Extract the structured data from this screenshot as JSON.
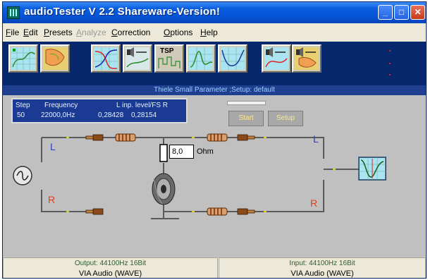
{
  "window": {
    "title": "audioTester  V 2.2 Shareware-Version!",
    "icons": [
      "app-icon",
      "minimize-icon",
      "maximize-icon",
      "close-icon"
    ]
  },
  "menu": {
    "items": [
      {
        "label": "File",
        "enabled": true
      },
      {
        "label": "Edit",
        "enabled": true
      },
      {
        "label": "Presets",
        "enabled": true
      },
      {
        "label": "Analyze",
        "enabled": false
      },
      {
        "label": "Correction",
        "enabled": true
      },
      {
        "label": "Options",
        "enabled": true
      },
      {
        "label": "Help",
        "enabled": true
      }
    ]
  },
  "toolbar": {
    "tsp_label": "TSP",
    "buttons": [
      "frequency-response-icon",
      "spectrum-map-icon",
      "filter-curve-icon",
      "speaker-sweep-icon",
      "tsp-icon",
      "waterfall-icon",
      "impedance-curve-icon",
      "speaker-curve-icon",
      "speaker-map-icon"
    ]
  },
  "status": {
    "text": "Thiele Small Parameter ;Setup:  default"
  },
  "info": {
    "step_header": "Step",
    "freq_header": "Frequency",
    "level_header": "L inp. level/FS R",
    "step": "50",
    "frequency": "22000,0Hz",
    "level_l": "0,28428",
    "level_r": "0,28154"
  },
  "controls": {
    "start_label": "Start",
    "setup_label": "Setup"
  },
  "circuit": {
    "resistor_value": "8,0",
    "resistor_unit": "Ohm",
    "left_in": "L",
    "right_in": "R",
    "left_out": "L",
    "right_out": "R",
    "colors": {
      "wire": "#5a5a5a",
      "left_label": "#2a3cc8",
      "right_label": "#e04020"
    }
  },
  "footer": {
    "output_format": "Output: 44100Hz 16Bit",
    "output_device": "VIA Audio (WAVE)",
    "input_format": "Input: 44100Hz 16Bit",
    "input_device": "VIA Audio (WAVE)"
  }
}
